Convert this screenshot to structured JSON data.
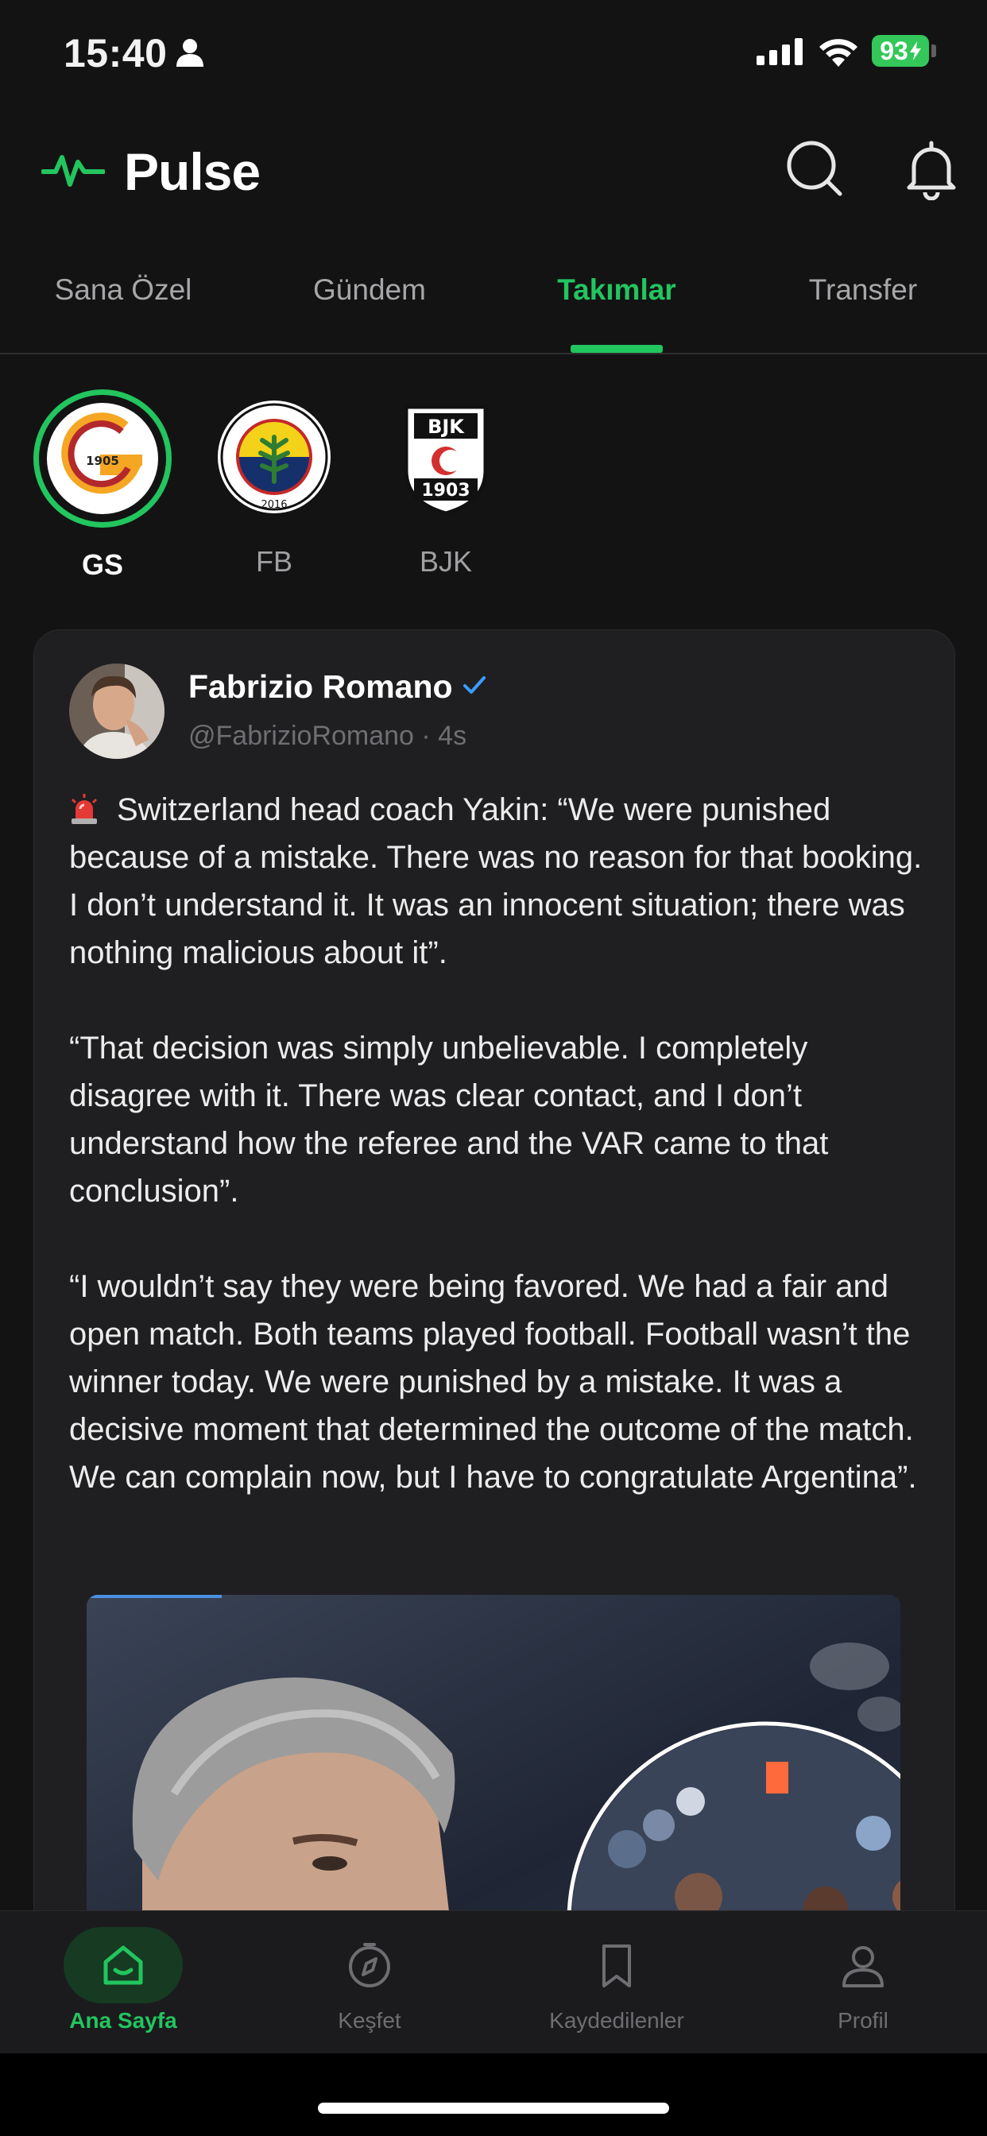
{
  "status_bar": {
    "time": "15:40",
    "battery": "93",
    "icons": [
      "person-icon",
      "signal-icon",
      "wifi-icon",
      "battery-icon"
    ]
  },
  "header": {
    "title": "Pulse",
    "icons": [
      "pulse-logo-icon",
      "search-icon",
      "bell-icon"
    ]
  },
  "tabs": {
    "items": [
      {
        "label": "Sana Özel"
      },
      {
        "label": "Gündem"
      },
      {
        "label": "Takımlar"
      },
      {
        "label": "Transfer"
      }
    ],
    "active": "Takımlar"
  },
  "teams": {
    "items": [
      {
        "label": "GS",
        "logo_text": "1905"
      },
      {
        "label": "FB",
        "logo_text": "2016"
      },
      {
        "label": "BJK",
        "logo_text": "BJK 1903"
      }
    ],
    "active": "GS"
  },
  "post": {
    "author": "Fabrizio Romano",
    "handle": "@FabrizioRomano",
    "time_ago": "4s",
    "handle_line": "@FabrizioRomano · 4s",
    "paragraphs": [
      "Switzerland head coach Yakin: “We were punished because of a mistake. There was no reason for that booking. I don’t understand it. It was an innocent situation; there was nothing malicious about it”.",
      "“That decision was simply unbelievable. I completely disagree with it. There was clear contact, and I don’t understand how the referee and the VAR came to that conclusion”.",
      "“I wouldn’t say they were being favored. We had a fair and open match. Both teams played football. Football wasn’t the winner today. We were punished by a mistake. It was a decisive moment that determined the outcome of the match. We can complain now, but I have to congratulate Argentina”."
    ],
    "icons": [
      "verified-icon",
      "siren-icon"
    ]
  },
  "bottom_nav": {
    "items": [
      {
        "label": "Ana Sayfa",
        "icon": "home-icon"
      },
      {
        "label": "Keşfet",
        "icon": "compass-icon"
      },
      {
        "label": "Kaydedilenler",
        "icon": "bookmark-icon"
      },
      {
        "label": "Profil",
        "icon": "profile-icon"
      }
    ],
    "active": "Ana Sayfa"
  },
  "colors": {
    "accent": "#22c55e",
    "background": "#131314",
    "card": "#1f1f21",
    "muted_text": "#a7a7aa"
  }
}
